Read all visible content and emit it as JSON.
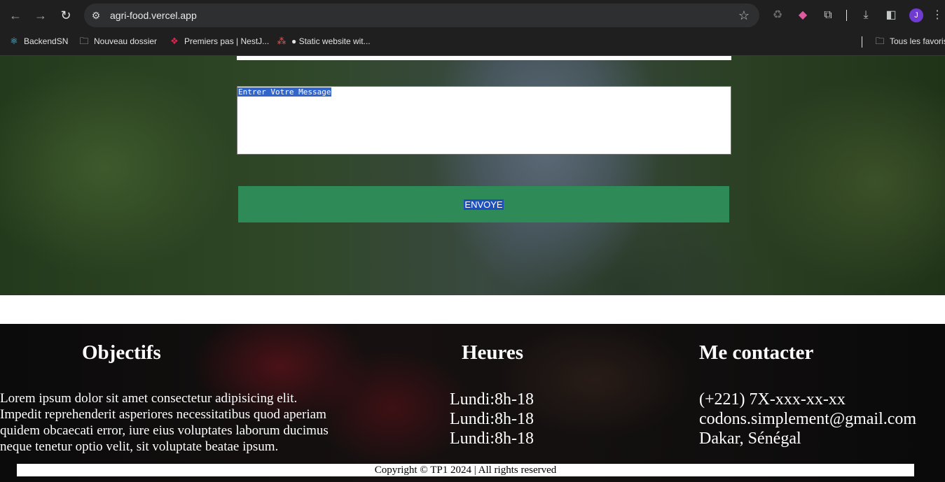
{
  "browser": {
    "url": "agri-food.vercel.app",
    "avatar_letter": "J",
    "bookmarks": [
      {
        "label": "BackendSN",
        "icon": "react-icon"
      },
      {
        "label": "Nouveau dossier",
        "icon": "folder-icon"
      },
      {
        "label": "Premiers pas | NestJ...",
        "icon": "nestjs-icon"
      },
      {
        "label": "● Static website wit...",
        "icon": "app-icon"
      }
    ],
    "all_bookmarks_label": "Tous les favoris"
  },
  "form": {
    "message_placeholder": "Entrer Votre Message",
    "submit_label": "ENVOYE"
  },
  "footer": {
    "objectifs": {
      "title": "Objectifs",
      "text_lines": [
        "Lorem ipsum dolor sit amet consectetur adipisicing elit.",
        "Impedit reprehenderit asperiores necessitatibus quod aperiam",
        "quidem obcaecati error, iure eius voluptates laborum ducimus",
        "neque tenetur optio velit, sit voluptate beatae ipsum."
      ]
    },
    "heures": {
      "title": "Heures",
      "lines": [
        "Lundi:8h-18",
        "Lundi:8h-18",
        "Lundi:8h-18"
      ]
    },
    "contact": {
      "title": "Me contacter",
      "lines": [
        "(+221) 7X-xxx-xx-xx",
        "codons.simplement@gmail.com",
        "Dakar, Sénégal"
      ]
    },
    "copyright": "Copyright © TP1 2024 | All rights reserved"
  },
  "colors": {
    "submit_button": "#2e8b57",
    "selection_highlight": "#3366cc",
    "browser_chrome": "#1f1f1f"
  }
}
